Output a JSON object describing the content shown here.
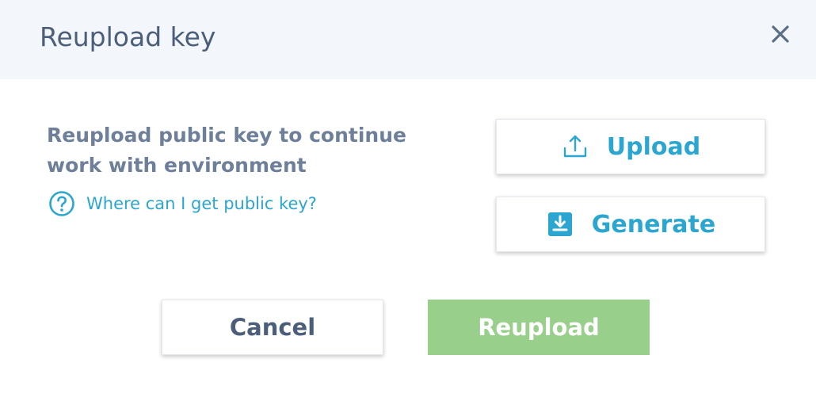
{
  "dialog": {
    "title": "Reupload key",
    "message": "Reupload public key to continue work with environment",
    "help_link": "Where can I get public key?",
    "upload_label": "Upload",
    "generate_label": "Generate",
    "cancel_label": "Cancel",
    "reupload_label": "Reupload"
  },
  "icons": {
    "close": "close-icon",
    "help": "question-circle-icon",
    "upload": "upload-icon",
    "generate": "download-box-icon"
  },
  "colors": {
    "header_bg": "#f3f7fb",
    "title": "#4c5f7a",
    "message": "#6d7f99",
    "accent": "#2aa6d0",
    "primary_disabled": "#98cf8a"
  }
}
